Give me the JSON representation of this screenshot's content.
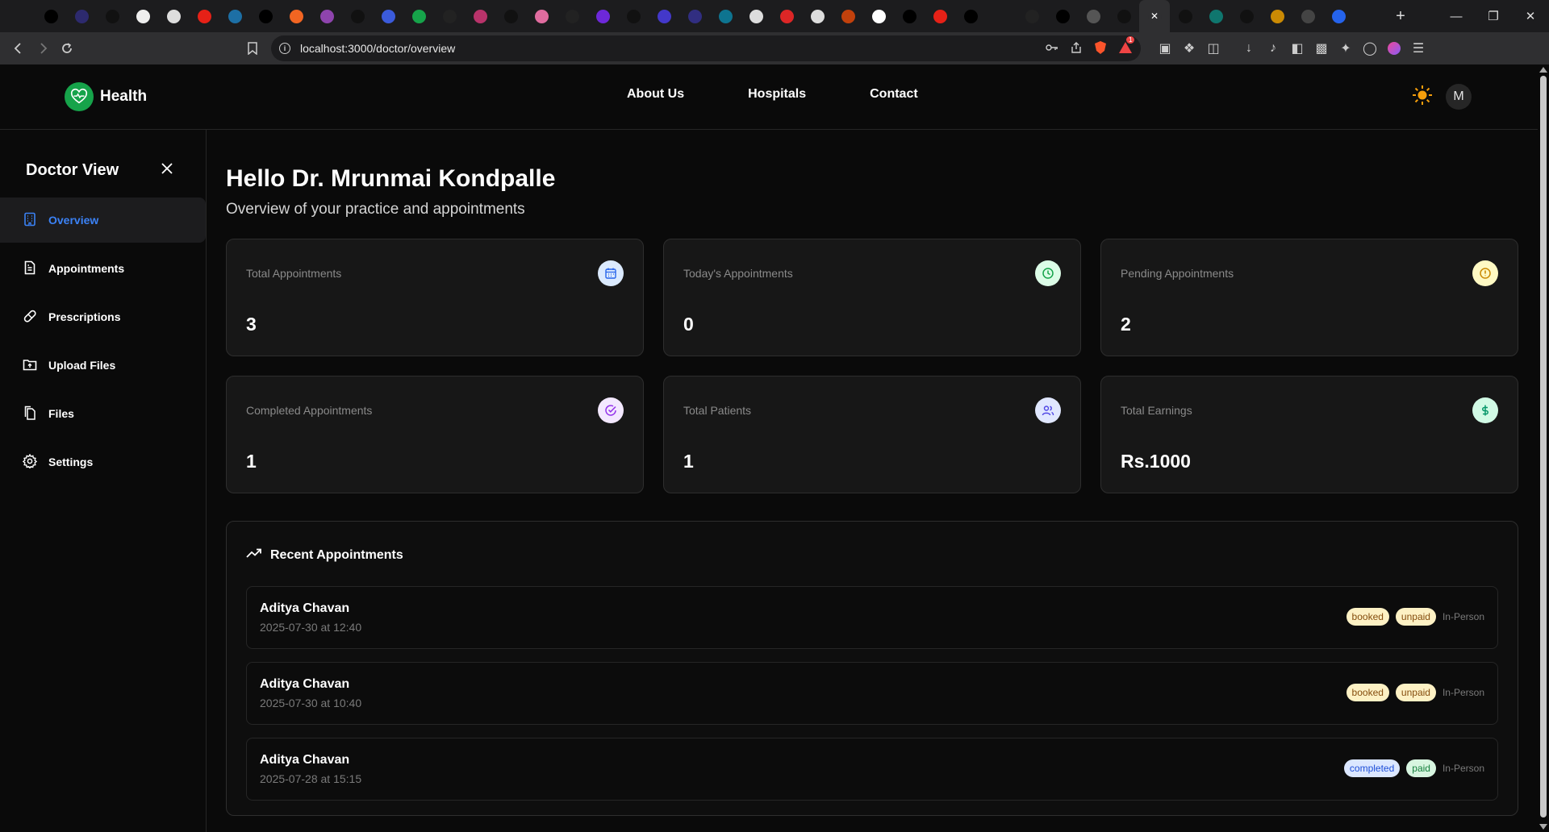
{
  "browser": {
    "tab_icons": [
      {
        "icon": "speaker-icon",
        "color": "#1c1c1e"
      },
      {
        "icon": "github-icon",
        "color": "#000000"
      },
      {
        "icon": "arc-icon",
        "color": "#2d2a6e"
      },
      {
        "icon": "edit-icon",
        "color": "#111111"
      },
      {
        "icon": "circle-icon",
        "color": "#eeeeee"
      },
      {
        "icon": "circle-icon",
        "color": "#dddddd"
      },
      {
        "icon": "youtube-icon",
        "color": "#e62117"
      },
      {
        "icon": "delta-icon",
        "color": "#1d6fa5"
      },
      {
        "icon": "github-icon",
        "color": "#000000"
      },
      {
        "icon": "orange-icon",
        "color": "#f26522"
      },
      {
        "icon": "hex-icon",
        "color": "#8e44ad"
      },
      {
        "icon": "disc-icon",
        "color": "#111111"
      },
      {
        "icon": "blue-c-icon",
        "color": "#3b5bdb"
      },
      {
        "icon": "green-icon",
        "color": "#16a34a"
      },
      {
        "icon": "openai-icon",
        "color": "#222222"
      },
      {
        "icon": "gradient-icon",
        "color": "#b8336a"
      },
      {
        "icon": "clock-icon",
        "color": "#111111"
      },
      {
        "icon": "pink-icon",
        "color": "#e06c9f"
      },
      {
        "icon": "openai-icon",
        "color": "#222222"
      },
      {
        "icon": "purple-icon",
        "color": "#6d28d9"
      },
      {
        "icon": "a-icon",
        "color": "#111111"
      },
      {
        "icon": "h-icon",
        "color": "#4338ca"
      },
      {
        "icon": "ui-icon",
        "color": "#312e81"
      },
      {
        "icon": "tailwind-icon",
        "color": "#0e7490"
      },
      {
        "icon": "person-icon",
        "color": "#dddddd"
      },
      {
        "icon": "red-n-icon",
        "color": "#dc2626"
      },
      {
        "icon": "person-icon",
        "color": "#dddddd"
      },
      {
        "icon": "chart-icon",
        "color": "#c2410c"
      },
      {
        "icon": "google-icon",
        "color": "#ffffff"
      },
      {
        "icon": "github-icon",
        "color": "#000000"
      },
      {
        "icon": "youtube-icon",
        "color": "#e62117"
      },
      {
        "icon": "github-icon",
        "color": "#000000"
      },
      {
        "icon": "square-icon",
        "color": "#1c1c1e"
      },
      {
        "icon": "moon-icon",
        "color": "#222222"
      },
      {
        "icon": "github-icon",
        "color": "#000000"
      },
      {
        "icon": "spiral-icon",
        "color": "#555555"
      },
      {
        "icon": "chatgpt-icon",
        "color": "#111111"
      },
      {
        "icon": "close-icon",
        "color": "#2f2f31"
      },
      {
        "icon": "chatgpt-icon",
        "color": "#111111"
      },
      {
        "icon": "teal-icon",
        "color": "#0f766e"
      },
      {
        "icon": "chatgpt-icon",
        "color": "#111111"
      },
      {
        "icon": "colorful-icon",
        "color": "#ca8a04"
      },
      {
        "icon": "edit-icon",
        "color": "#444444"
      },
      {
        "icon": "blue-square-icon",
        "color": "#2563eb"
      },
      {
        "icon": "cloud-icon",
        "color": "#1c1c1e"
      }
    ],
    "url": "localhost:3000/doctor/overview",
    "notification_count": "1"
  },
  "topnav": {
    "brand": "Health",
    "links": [
      "About Us",
      "Hospitals",
      "Contact"
    ],
    "avatar_initial": "M"
  },
  "sidebar": {
    "title": "Doctor View",
    "items": [
      {
        "label": "Overview",
        "icon": "building-icon",
        "active": true
      },
      {
        "label": "Appointments",
        "icon": "document-icon",
        "active": false
      },
      {
        "label": "Prescriptions",
        "icon": "pill-icon",
        "active": false
      },
      {
        "label": "Upload Files",
        "icon": "upload-icon",
        "active": false
      },
      {
        "label": "Files",
        "icon": "files-icon",
        "active": false
      },
      {
        "label": "Settings",
        "icon": "gear-icon",
        "active": false
      }
    ]
  },
  "main": {
    "greeting": "Hello Dr. Mrunmai Kondpalle",
    "subtitle": "Overview of your practice and appointments",
    "stats": [
      {
        "label": "Total Appointments",
        "value": "3",
        "icon": "calendar-icon",
        "bg": "#dbeafe",
        "fg": "#2563eb"
      },
      {
        "label": "Today's Appointments",
        "value": "0",
        "icon": "clock-icon",
        "bg": "#dcfce7",
        "fg": "#16a34a"
      },
      {
        "label": "Pending Appointments",
        "value": "2",
        "icon": "alert-icon",
        "bg": "#fef9c3",
        "fg": "#ca8a04"
      },
      {
        "label": "Completed Appointments",
        "value": "1",
        "icon": "check-circle-icon",
        "bg": "#f3e8ff",
        "fg": "#9333ea"
      },
      {
        "label": "Total Patients",
        "value": "1",
        "icon": "users-icon",
        "bg": "#e0e7ff",
        "fg": "#4f46e5"
      },
      {
        "label": "Total Earnings",
        "value": "Rs.1000",
        "icon": "dollar-icon",
        "bg": "#d1fae5",
        "fg": "#059669"
      }
    ],
    "recent": {
      "title": "Recent Appointments",
      "items": [
        {
          "name": "Aditya Chavan",
          "when": "2025-07-30 at 12:40",
          "status": "booked",
          "payment": "unpaid",
          "mode": "In-Person"
        },
        {
          "name": "Aditya Chavan",
          "when": "2025-07-30 at 10:40",
          "status": "booked",
          "payment": "unpaid",
          "mode": "In-Person"
        },
        {
          "name": "Aditya Chavan",
          "when": "2025-07-28 at 15:15",
          "status": "completed",
          "payment": "paid",
          "mode": "In-Person"
        }
      ]
    }
  }
}
